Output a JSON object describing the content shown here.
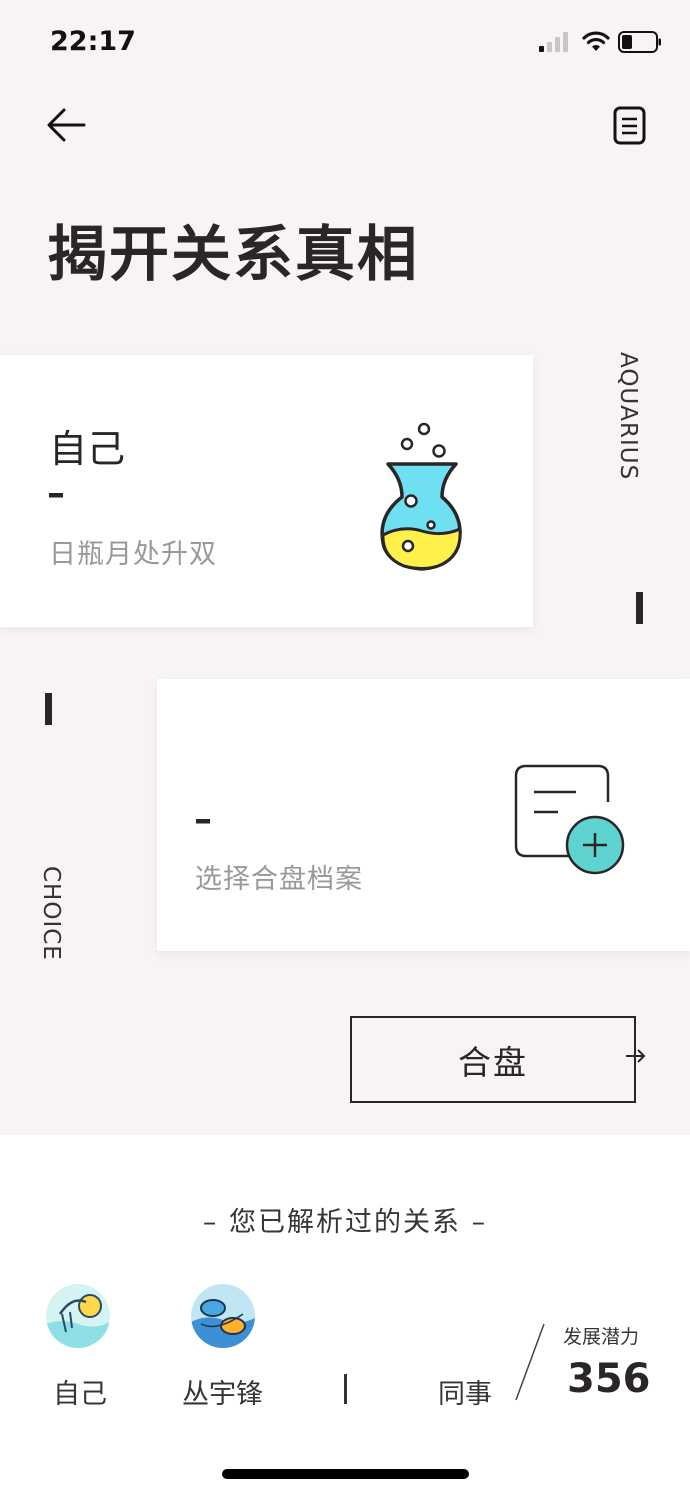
{
  "status_bar": {
    "time": "22:17"
  },
  "header": {
    "title": "揭开关系真相"
  },
  "side_labels": {
    "top": "AQUARIUS",
    "bottom": "CHOICE"
  },
  "self_card": {
    "title": "自己",
    "dash": "–",
    "subtitle": "日瓶月处升双",
    "icon": "potion-flask-icon"
  },
  "partner_card": {
    "dash": "–",
    "subtitle": "选择合盘档案",
    "icon": "add-profile-icon"
  },
  "combine_button": {
    "label": "合盘"
  },
  "history": {
    "title": "– 您已解析过的关系 –",
    "items": [
      {
        "name": "自己",
        "avatar": "aquarius-avatar"
      },
      {
        "name": "丛宇锋",
        "avatar": "pisces-avatar"
      }
    ],
    "relation": "同事",
    "potential_label": "发展潜力",
    "potential_value": "356"
  },
  "colors": {
    "background": "#f8f4f5",
    "text": "#2a2626",
    "teal": "#5fd3d0",
    "yellow": "#fff04a",
    "cyan": "#6fdff2"
  }
}
